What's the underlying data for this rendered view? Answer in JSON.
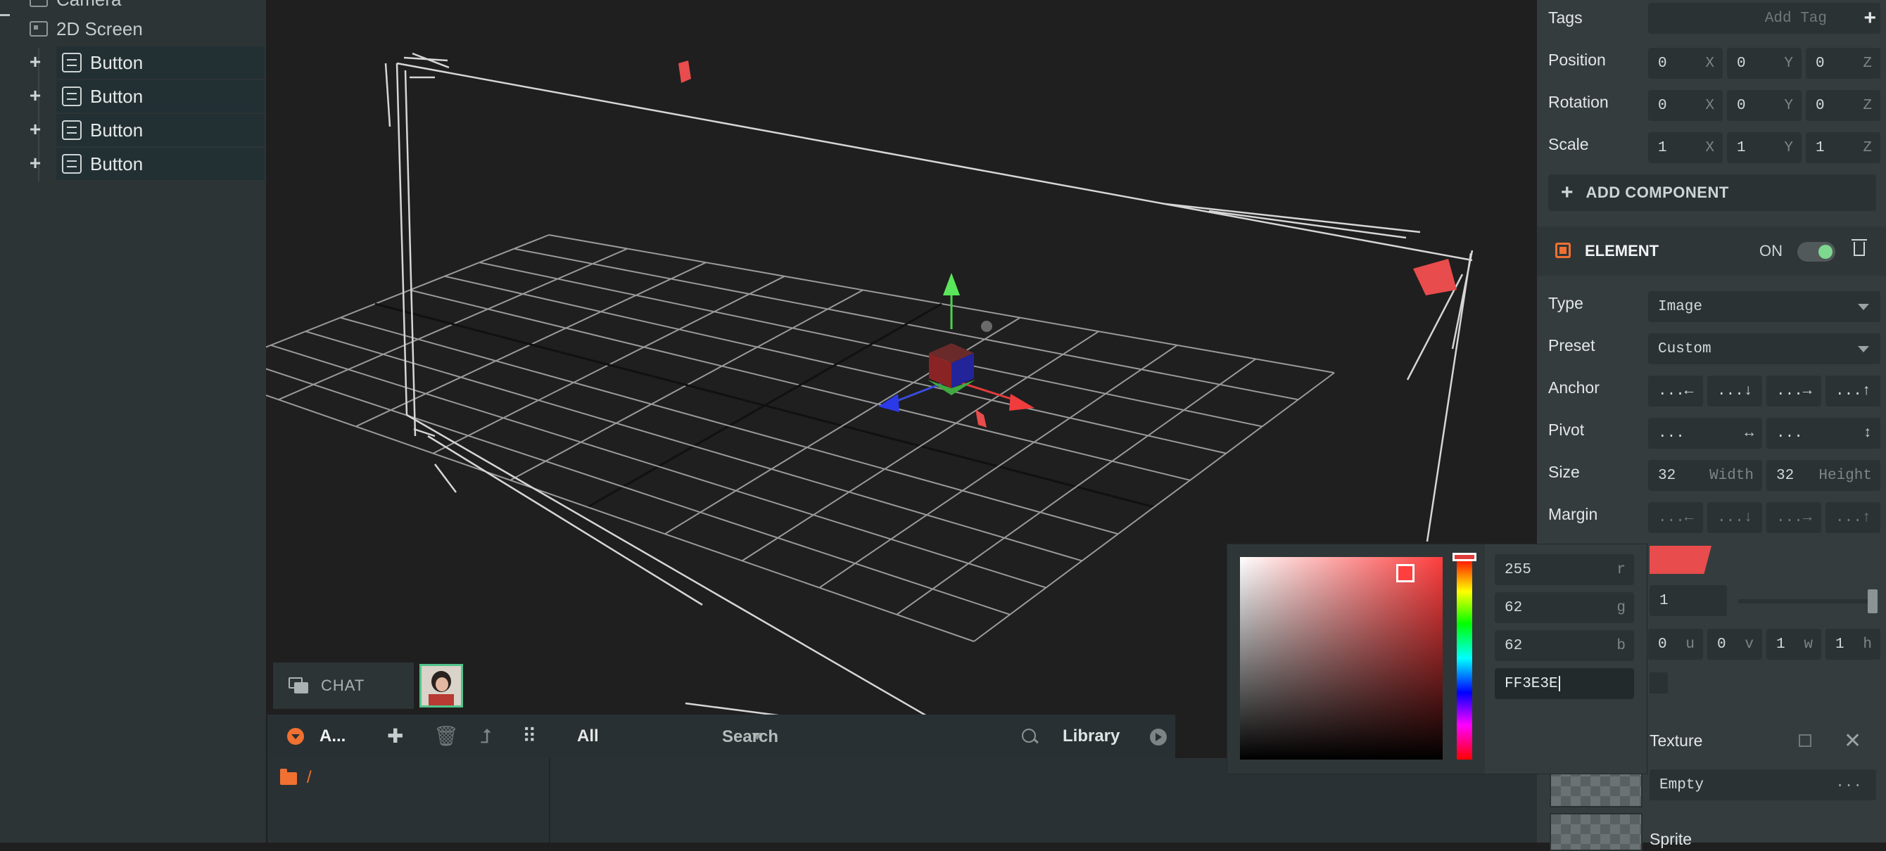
{
  "hierarchy": {
    "camera_label": "Camera",
    "screen_label": "2D Screen",
    "buttons": [
      "Button",
      "Button",
      "Button",
      "Button"
    ],
    "expand_symbol": "+"
  },
  "chat": {
    "label": "CHAT"
  },
  "assets": {
    "title": "A...",
    "filter": "All",
    "search_placeholder": "Search",
    "library_label": "Library",
    "root_path": "/",
    "icons": [
      "add-icon",
      "trash-icon",
      "move-up-icon",
      "grid-view-icon"
    ]
  },
  "inspector": {
    "tags_label": "Tags",
    "tags_placeholder": "Add Tag",
    "tags_add": "+",
    "position_label": "Position",
    "position": [
      "0",
      "0",
      "0"
    ],
    "rotation_label": "Rotation",
    "rotation": [
      "0",
      "0",
      "0"
    ],
    "scale_label": "Scale",
    "scale": [
      "1",
      "1",
      "1"
    ],
    "axes": [
      "X",
      "Y",
      "Z"
    ],
    "add_component_label": "ADD COMPONENT",
    "element": {
      "title": "ELEMENT",
      "state": "ON",
      "enabled": true,
      "type_label": "Type",
      "type_value": "Image",
      "preset_label": "Preset",
      "preset_value": "Custom",
      "anchor_label": "Anchor",
      "anchor": [
        "...←",
        "...↓",
        "...→",
        "...↑"
      ],
      "pivot_label": "Pivot",
      "pivot": [
        "...",
        "↔",
        "...",
        "↕"
      ],
      "size_label": "Size",
      "size": [
        "32",
        "32"
      ],
      "size_units": [
        "Width",
        "Height"
      ],
      "margin_label": "Margin",
      "margin": [
        "...←",
        "...↓",
        "...→",
        "...↑"
      ],
      "color": "#FF3E3E",
      "opacity": "1",
      "rect": [
        "0",
        "0",
        "1",
        "1"
      ],
      "rect_units": [
        "u",
        "v",
        "w",
        "h"
      ],
      "texture_label": "Texture",
      "texture_value": "Empty",
      "texture_more": "...",
      "sprite_label": "Sprite"
    }
  },
  "color_picker": {
    "r": "255",
    "g": "62",
    "b": "62",
    "channels": [
      "r",
      "g",
      "b"
    ],
    "hex": "FF3E3E"
  },
  "colors": {
    "accent": "#f07032",
    "selected_color": "#ff3e3e",
    "toggle_on": "#7ed88e"
  }
}
